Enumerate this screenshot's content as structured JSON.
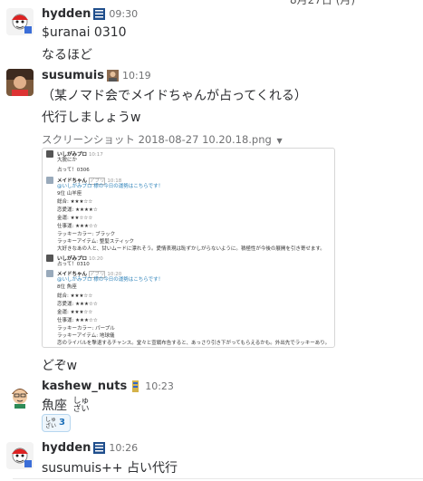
{
  "date_peek": "8月27日 (月)",
  "messages": [
    {
      "name": "hydden",
      "time": "09:30",
      "lines": [
        "$uranai 0310",
        "なるほど"
      ]
    },
    {
      "name": "susumuis",
      "time": "10:19",
      "lines": [
        "（某ノマド会でメイドちゃんが占ってくれる）",
        "代行しましょうw"
      ],
      "file": "スクリーンショット 2018-08-27 10.20.18.png",
      "after": "どぞw"
    },
    {
      "name": "kashew_nuts",
      "time": "10:23",
      "text": "魚座",
      "ruby_top": "しゅ",
      "ruby_bottom": "ざい",
      "reaction_count": "3",
      "reaction_emoji_top": "しゅ",
      "reaction_emoji_bottom": "ざい"
    },
    {
      "name": "hydden",
      "time": "10:26",
      "text": "susumuis++ 占い代行"
    }
  ],
  "thumb": {
    "m1_name": "いしがみプロ",
    "m1_time": "10:17",
    "m1_l1": "大脱にか",
    "m1_l2": "占って！0306",
    "m2_name": "メイドちゃん",
    "m2_tag": "アプリ",
    "m2_time": "10:18",
    "m2_l1": "@いしがみプロ 様の今日の運勢はこちらです！",
    "m2_l2": "9位 山羊座",
    "m2_rows": [
      "総合: ★★★☆☆",
      "恋愛運: ★★★★☆",
      "金運: ★★☆☆☆",
      "仕事運: ★★★☆☆",
      "ラッキーカラー: ブラック",
      "ラッキーアイテム: 整髪スティック",
      "大好きなあの人と、甘いムードに漂れそう。愛情表現は恥ずかしがらないように。積極性が今後の展開を引き寄せます。"
    ],
    "m3_name": "いしがみプロ",
    "m3_time": "10:20",
    "m3_l1": "占って！0310",
    "m4_name": "メイドちゃん",
    "m4_tag": "アプリ",
    "m4_time": "10:20",
    "m4_l1": "@いしがみプロ 様の今日の運勢はこちらです！",
    "m4_l2": "8位 魚座",
    "m4_rows": [
      "総合: ★★★☆☆",
      "恋愛運: ★★★☆☆",
      "金運: ★★★☆☆",
      "仕事運: ★★★☆☆",
      "ラッキーカラー: パープル",
      "ラッキーアイテム: 地球儀",
      "恋のライバルを撃退するチャンス。堂々と宣戦布告すると、あっさり引き下がってもらえるかも。外出先でラッキーあり。"
    ]
  }
}
